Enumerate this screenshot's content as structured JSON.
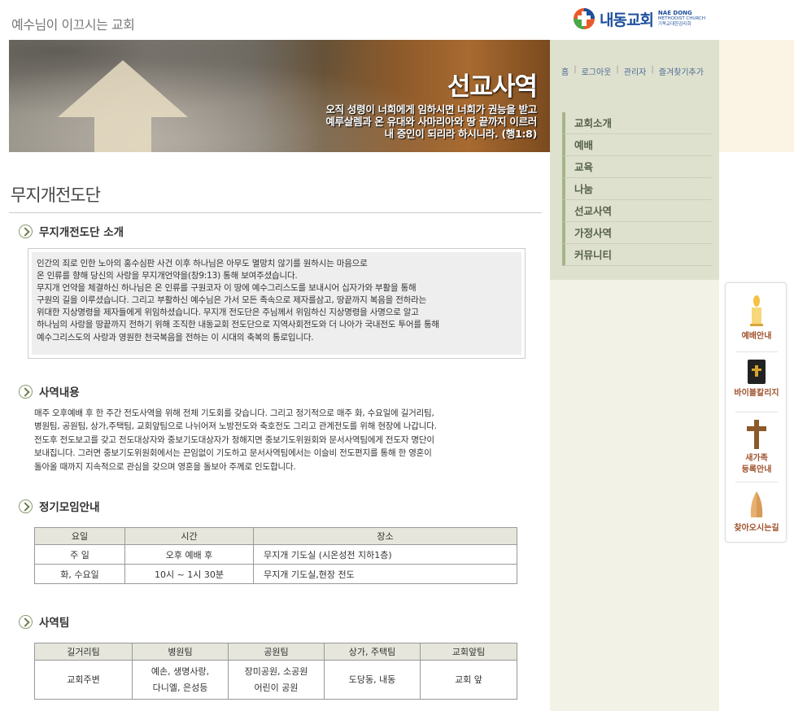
{
  "header": {
    "slogan": "예수님이 이끄시는 교회",
    "logo_text": "내동교회",
    "logo_sub_line1": "NAE DONG",
    "logo_sub_line2": "METHODIST CHURCH",
    "logo_sub_line3": "기독교대한감리회"
  },
  "banner": {
    "title": "선교사역",
    "verse_line1": "오직 성령이 너희에게 임하시면 너희가 권능을 받고",
    "verse_line2": "예루살렘과 온 유대와 사마리아와 땅 끝까지 이르러",
    "verse_line3": "내 증인이 되리라 하시니라. (행1:8)"
  },
  "toplinks": [
    "홈",
    "로그아웃",
    "관리자",
    "즐겨찾기추가"
  ],
  "menu": [
    "교회소개",
    "예배",
    "교육",
    "나눔",
    "선교사역",
    "가정사역",
    "커뮤니티"
  ],
  "quick": [
    {
      "label": "예배안내",
      "icon": "candle-icon"
    },
    {
      "label": "바이블칼리지",
      "icon": "bible-icon"
    },
    {
      "label": "새가족\n등록안내",
      "icon": "cross-icon"
    },
    {
      "label": "찾아오시는길",
      "icon": "praying-hands-icon"
    }
  ],
  "quick_labels": {
    "worship": "예배안내",
    "bible": "바이블칼리지",
    "newfamily_1": "새가족",
    "newfamily_2": "등록안내",
    "directions": "찾아오시는길"
  },
  "page_title": "무지개전도단",
  "sections": {
    "intro_heading": "무지개전도단 소개",
    "intro_lines": [
      "인간의 죄로 인한 노아의 홍수심판 사건 이후 하나님은 아무도 멸망치 않기를 원하시는 마음으로",
      "온 인류를 향해 당신의 사랑을 무지개언약을(창9:13) 통해 보여주셨습니다.",
      "무지개 언약을 체결하신 하나님은 온 인류를 구원코자 이 땅에 예수그리스도를 보내시어 십자가와 부활을 통해",
      "구원의 길을 이루셨습니다. 그리고 부활하신 예수님은 가서 모든 족속으로 제자를삼고, 땅끝까지 복음을 전하라는",
      "위대한 지상명령을 제자들에게 위임하셨습니다. 무지개 전도단은 주님께서 위임하신 지상명령을 사명으로 알고",
      "하나님의 사랑을 땅끝까지 전하기 위해 조직한 내동교회 전도단으로 지역사회전도와 더 나아가 국내전도 투어를 통해",
      "예수그리스도의 사랑과 영원한 천국복음을 전하는 이 시대의 축복의 통로입니다."
    ],
    "ministry_heading": "사역내용",
    "ministry_lines": [
      "매주 오후예배 후 한 주간 전도사역을 위해 전체 기도회를 갖습니다. 그리고 정기적으로 매주 화, 수요일에 길거리팀,",
      "병원팀, 공원팀, 상가,주택팀, 교회앞팀으로 나뉘어져 노방전도와 축호전도 그리고 관계전도를 위해 현장에 나갑니다.",
      "전도후 전도보고를 갖고 전도대상자와 중보기도대상자가 정해지면 중보기도위원회와 문서사역팀에게 전도자 명단이",
      "보내집니다. 그러면 중보기도위원회에서는 끈임없이 기도하고 문서사역팀에서는 이슬비 전도편지를 통해 한 영혼이",
      "돌아올 때까지 지속적으로 관심을 갖으며 영혼을 돌보아 주께로 인도합니다."
    ],
    "meeting_heading": "정기모임안내",
    "team_heading": "사역팀"
  },
  "meeting_table": {
    "headers": [
      "요일",
      "시간",
      "장소"
    ],
    "rows": [
      [
        "주 일",
        "오후 예배 후",
        "무지개 기도실 (시온성전 지하1층)"
      ],
      [
        "화, 수요일",
        "10시 ~ 1시 30분",
        "무지개 기도실,현장 전도"
      ]
    ]
  },
  "team_table": {
    "headers": [
      "길거리팀",
      "병원팀",
      "공원팀",
      "상가, 주택팀",
      "교회앞팀"
    ],
    "row": [
      [
        "교회주변"
      ],
      [
        "예손, 생명사랑,",
        "다니엘, 은성등"
      ],
      [
        "장미공원, 소공원",
        "어린이 공원"
      ],
      [
        "도당동, 내동"
      ],
      [
        "교회 앞"
      ]
    ]
  },
  "colors": {
    "logo_blue": "#1d4f9c",
    "menu_bg": "#dfe1cf",
    "right_bg": "#f2f3e6",
    "menu_bar": "#a7b48a",
    "table_header": "#e6e6dc"
  }
}
